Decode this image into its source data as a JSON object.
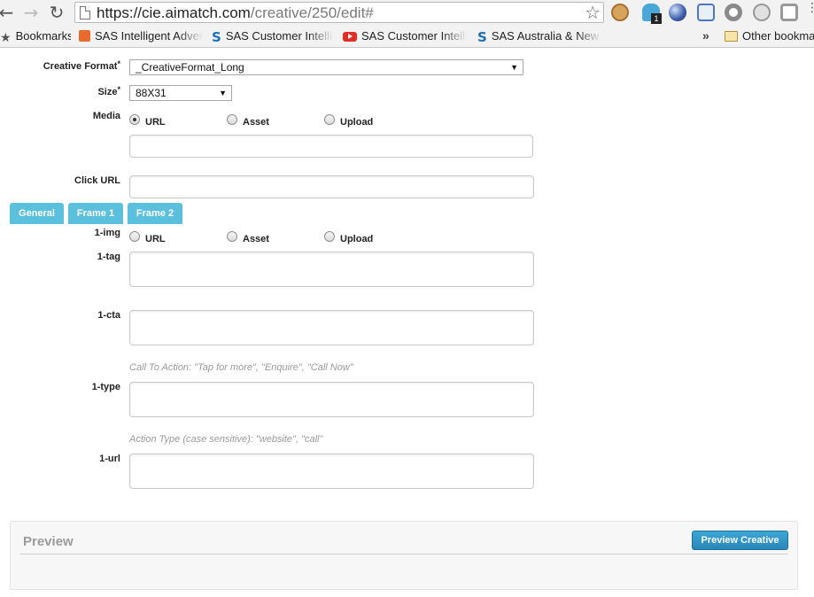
{
  "browser": {
    "url_host": "https://cie.aimatch.com",
    "url_path": "/creative/250/edit#",
    "ghost_badge": "1",
    "extension_icons": [
      "cookie-icon",
      "ghost-icon",
      "globe-icon",
      "sync-icon",
      "ring-icon",
      "house-icon",
      "square-icon"
    ]
  },
  "bookmarks": {
    "label": "Bookmarks",
    "items": [
      {
        "label": "SAS Intelligent Advert",
        "icon": "orange-square-icon"
      },
      {
        "label": "SAS Customer Intellig",
        "icon": "sas-icon"
      },
      {
        "label": "SAS Customer Intellig",
        "icon": "youtube-icon"
      },
      {
        "label": "SAS Australia & New Z",
        "icon": "sas-icon"
      }
    ],
    "overflow": "»",
    "other": "Other bookmarks"
  },
  "form": {
    "creative_format_label": "Creative Format",
    "creative_format_value": "_CreativeFormat_Long",
    "size_label": "Size",
    "size_value": "88X31",
    "required_mark": "*",
    "media_label": "Media",
    "media_options": [
      "URL",
      "Asset",
      "Upload"
    ],
    "media_selected": "URL",
    "media_value": "",
    "click_url_label": "Click URL",
    "click_url_value": ""
  },
  "tabs": [
    "General",
    "Frame 1",
    "Frame 2"
  ],
  "frame": {
    "img_label": "1-img",
    "img_options": [
      "URL",
      "Asset",
      "Upload"
    ],
    "tag_label": "1-tag",
    "tag_value": "",
    "cta_label": "1-cta",
    "cta_value": "",
    "cta_hint": "Call To Action: \"Tap for more\", \"Enquire\", \"Call Now\"",
    "type_label": "1-type",
    "type_value": "",
    "type_hint": "Action Type (case sensitive): \"website\", \"call\"",
    "url_label": "1-url",
    "url_value": ""
  },
  "preview": {
    "title": "Preview",
    "button": "Preview Creative"
  },
  "colors": {
    "tab_bg": "#5bc0de",
    "button_bg": "#2a86b8"
  }
}
